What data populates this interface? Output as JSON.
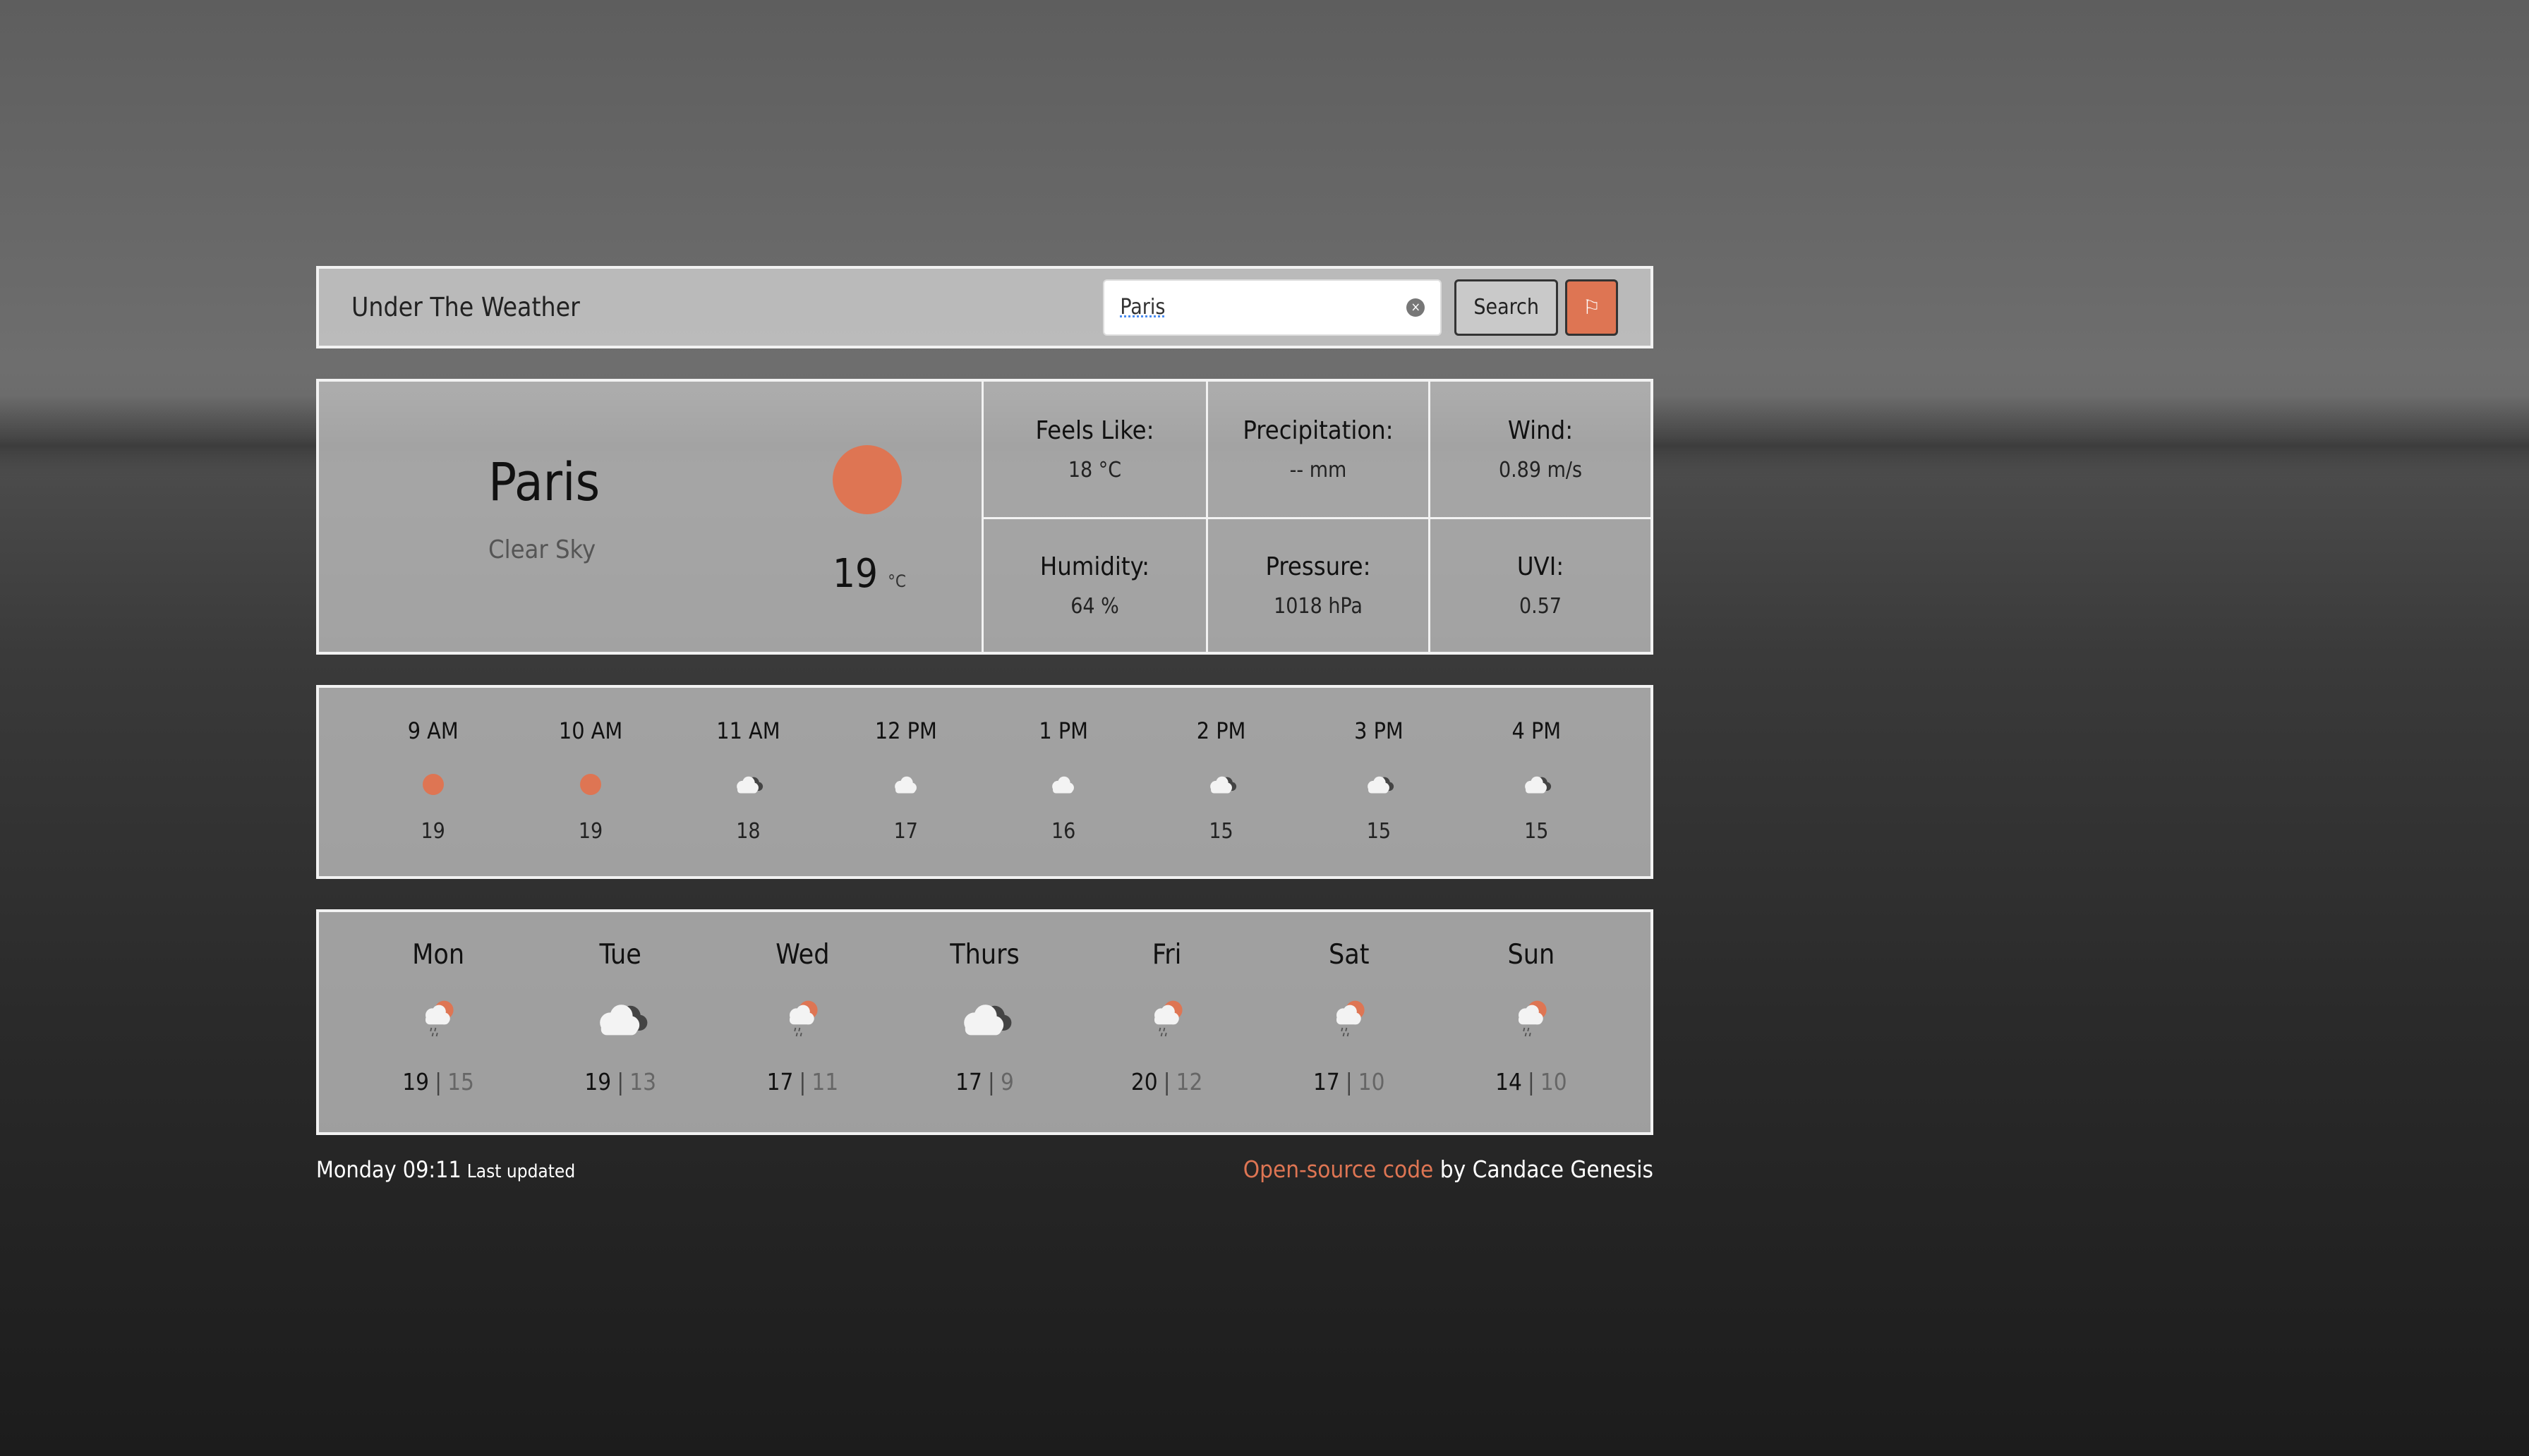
{
  "header": {
    "title": "Under The Weather",
    "search_value": "Paris",
    "search_label": "Search",
    "flag_icon": "flag-icon"
  },
  "colors": {
    "accent": "#de7553",
    "panel_border": "#f2f2f2"
  },
  "current": {
    "city": "Paris",
    "description": "Clear Sky",
    "temp": "19",
    "unit": "°C",
    "icon": "sun-icon",
    "details": [
      {
        "label": "Feels Like:",
        "value": "18 °C"
      },
      {
        "label": "Precipitation:",
        "value": "-- mm"
      },
      {
        "label": "Wind:",
        "value": "0.89 m/s"
      },
      {
        "label": "Humidity:",
        "value": "64 %"
      },
      {
        "label": "Pressure:",
        "value": "1018 hPa"
      },
      {
        "label": "UVI:",
        "value": "0.57"
      }
    ]
  },
  "hourly": [
    {
      "time": "9 AM",
      "icon": "sun",
      "temp": "19"
    },
    {
      "time": "10 AM",
      "icon": "sun",
      "temp": "19"
    },
    {
      "time": "11 AM",
      "icon": "cloud-dark",
      "temp": "18"
    },
    {
      "time": "12 PM",
      "icon": "cloud",
      "temp": "17"
    },
    {
      "time": "1 PM",
      "icon": "cloud",
      "temp": "16"
    },
    {
      "time": "2 PM",
      "icon": "cloud-dark",
      "temp": "15"
    },
    {
      "time": "3 PM",
      "icon": "cloud-dark",
      "temp": "15"
    },
    {
      "time": "4 PM",
      "icon": "cloud-dark",
      "temp": "15"
    }
  ],
  "daily": [
    {
      "day": "Mon",
      "icon": "sun-rain",
      "high": "19",
      "low": "15"
    },
    {
      "day": "Tue",
      "icon": "clouds",
      "high": "19",
      "low": "13"
    },
    {
      "day": "Wed",
      "icon": "sun-rain",
      "high": "17",
      "low": "11"
    },
    {
      "day": "Thurs",
      "icon": "clouds",
      "high": "17",
      "low": "9"
    },
    {
      "day": "Fri",
      "icon": "sun-rain",
      "high": "20",
      "low": "12"
    },
    {
      "day": "Sat",
      "icon": "sun-rain",
      "high": "17",
      "low": "10"
    },
    {
      "day": "Sun",
      "icon": "sun-rain",
      "high": "14",
      "low": "10"
    }
  ],
  "footer": {
    "updated": "Monday 09:11",
    "updated_label": "Last updated",
    "link": "Open-source code",
    "by": "by Candace Genesis"
  }
}
